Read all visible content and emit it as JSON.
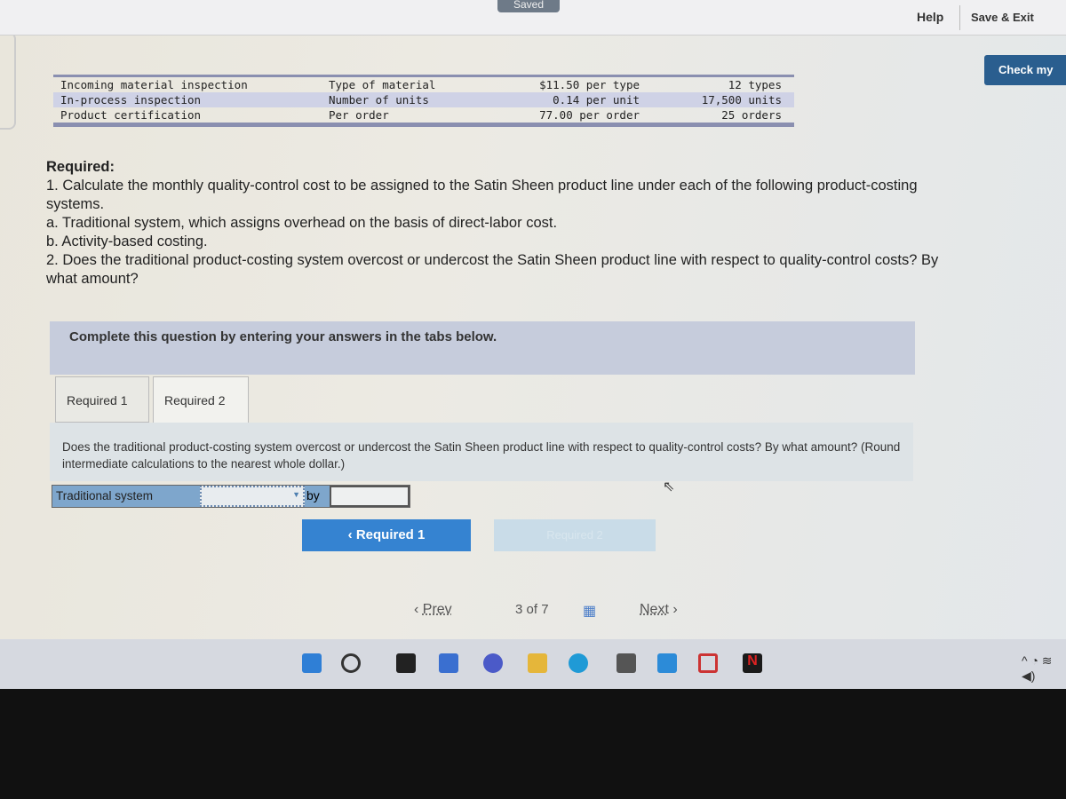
{
  "header": {
    "saved_label": "Saved",
    "help_label": "Help",
    "save_exit_label": "Save & Exit",
    "check_label": "Check my"
  },
  "data_table": {
    "rows": [
      {
        "activity": "Incoming material inspection",
        "driver": "Type of material",
        "rate": "$11.50 per type",
        "quantity": "12 types"
      },
      {
        "activity": "In-process inspection",
        "driver": "Number of units",
        "rate": "0.14 per unit",
        "quantity": "17,500 units"
      },
      {
        "activity": "Product certification",
        "driver": "Per order",
        "rate": "77.00 per order",
        "quantity": "25 orders"
      }
    ]
  },
  "required": {
    "heading": "Required:",
    "line1": "1. Calculate the monthly quality-control cost to be assigned to the Satin Sheen product line under each of the following product-costing systems.",
    "line_a": "a. Traditional system, which assigns overhead on the basis of direct-labor cost.",
    "line_b": "b. Activity-based costing.",
    "line2": "2. Does the traditional product-costing system overcost or undercost the Satin Sheen product line with respect to quality-control costs? By what amount?"
  },
  "instructions": "Complete this question by entering your answers in the tabs below.",
  "tabs": [
    {
      "label": "Required 1"
    },
    {
      "label": "Required 2"
    }
  ],
  "question": "Does the traditional product-costing system overcost or undercost the Satin Sheen product line with respect to quality-control costs? By what amount? (Round intermediate calculations to the nearest whole dollar.)",
  "answer": {
    "label": "Traditional system",
    "select_value": "",
    "by_label": "by",
    "amount_value": ""
  },
  "buttons": {
    "prev_required": "Required 1",
    "next_required": "Required 2"
  },
  "pagination": {
    "prev": "Prev",
    "current": "3",
    "of_label": "of 7",
    "next": "Next"
  },
  "colors": {
    "accent": "#3583d1",
    "label_bg": "#7ea6cc"
  }
}
